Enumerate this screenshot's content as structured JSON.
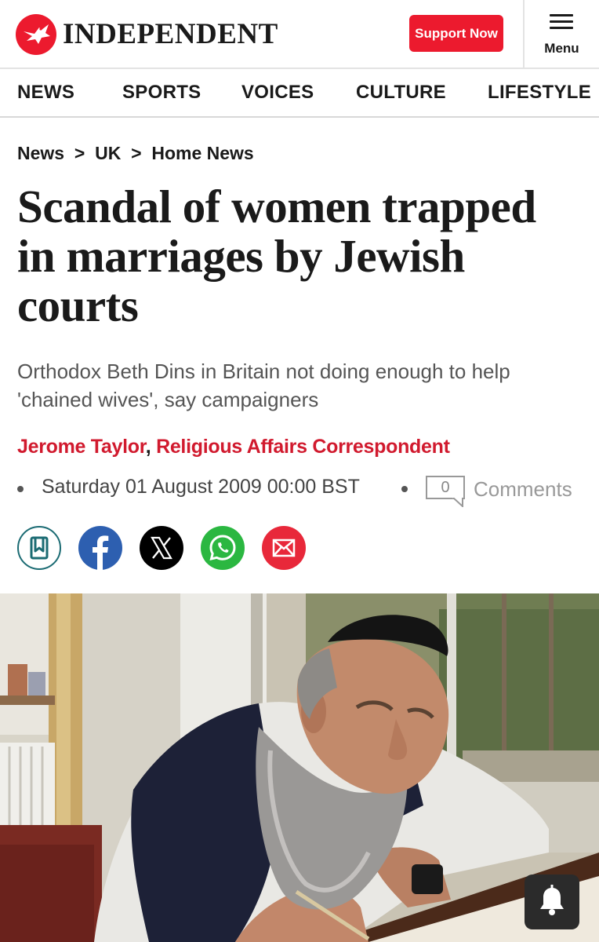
{
  "header": {
    "brand": "INDEPENDENT",
    "support_label": "Support Now",
    "menu_label": "Menu"
  },
  "nav": {
    "items": [
      "NEWS",
      "SPORTS",
      "VOICES",
      "CULTURE",
      "LIFESTYLE"
    ]
  },
  "article": {
    "breadcrumb": [
      "News",
      "UK",
      "Home News"
    ],
    "headline": "Scandal of women trapped in marriages by Jewish courts",
    "standfirst": "Orthodox Beth Dins in Britain not doing enough to help 'chained wives', say campaigners",
    "author": "Jerome Taylor",
    "author_role": "Religious Affairs Correspondent",
    "date": "Saturday 01 August 2009 00:00 BST",
    "comment_count": "0",
    "comments_label": "Comments"
  },
  "share": {
    "icons": [
      "bookmark-icon",
      "facebook-icon",
      "x-icon",
      "whatsapp-icon",
      "email-icon"
    ]
  },
  "colors": {
    "brand_red": "#ec1a2e",
    "byline_red": "#d11a2e",
    "bookmark_teal": "#1b6b73",
    "facebook_blue": "#2d5fb0",
    "whatsapp_green": "#2bb741",
    "email_red": "#e8283a"
  }
}
